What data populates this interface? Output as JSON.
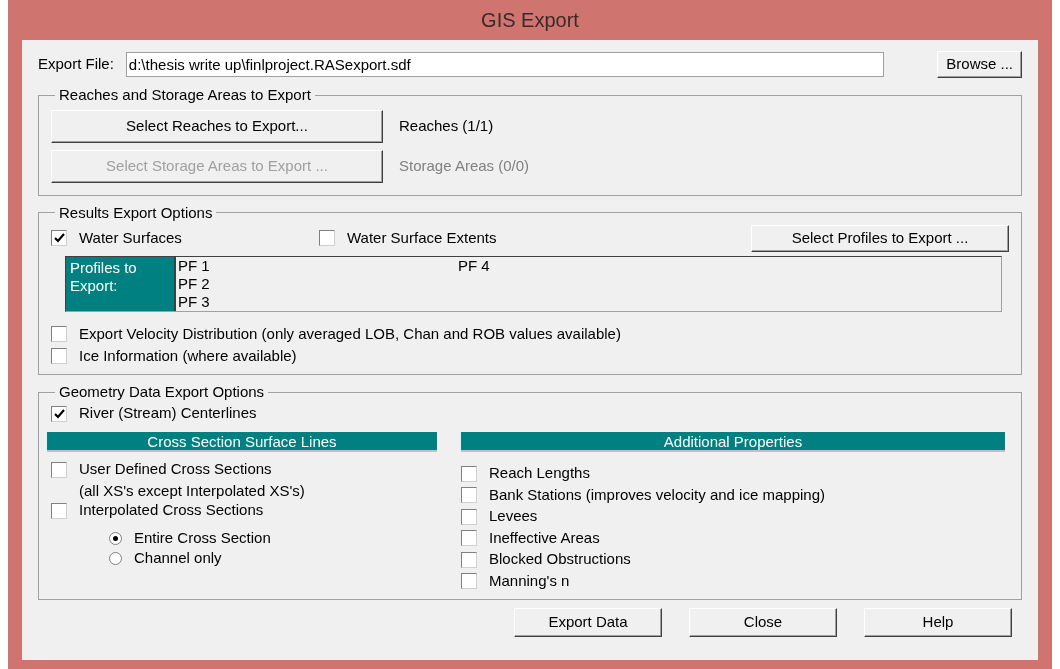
{
  "window": {
    "title": "GIS Export"
  },
  "export_file": {
    "label": "Export File:",
    "value": "d:\\thesis write up\\finlproject.RASexport.sdf",
    "browse": "Browse ..."
  },
  "reaches_group": {
    "title": "Reaches and Storage Areas to Export",
    "rows": [
      {
        "button": "Select Reaches to Export...",
        "disabled": false,
        "status": "Reaches (1/1)"
      },
      {
        "button": "Select Storage Areas to Export ...",
        "disabled": true,
        "status": "Storage Areas (0/0)"
      }
    ]
  },
  "results_group": {
    "title": "Results Export Options",
    "water_surfaces": {
      "label": "Water Surfaces",
      "checked": true
    },
    "water_surface_extents": {
      "label": "Water Surface Extents",
      "checked": false
    },
    "select_profiles": "Select Profiles to Export ...",
    "profiles_label": "Profiles to Export:",
    "profiles": [
      "PF 1",
      "PF 2",
      "PF 3",
      "PF 4"
    ],
    "options": [
      {
        "label": "Export Velocity Distribution (only averaged LOB, Chan and ROB values available)",
        "checked": false
      },
      {
        "label": "Ice Information (where available)",
        "checked": false
      }
    ]
  },
  "geometry_group": {
    "title": "Geometry Data Export Options",
    "centerlines": {
      "label": "River (Stream) Centerlines",
      "checked": true
    },
    "cross_section": {
      "header": "Cross Section Surface Lines",
      "items": [
        {
          "label": "User Defined Cross Sections",
          "note": "(all XS's except Interpolated XS's)",
          "checked": false
        },
        {
          "label": "Interpolated Cross Sections",
          "checked": false
        }
      ],
      "extent": [
        {
          "label": "Entire Cross Section",
          "selected": true
        },
        {
          "label": "Channel only",
          "selected": false
        }
      ]
    },
    "additional": {
      "header": "Additional Properties",
      "items": [
        {
          "label": "Reach Lengths",
          "checked": false
        },
        {
          "label": "Bank Stations (improves velocity and ice mapping)",
          "checked": false
        },
        {
          "label": "Levees",
          "checked": false
        },
        {
          "label": "Ineffective Areas",
          "checked": false
        },
        {
          "label": "Blocked Obstructions",
          "checked": false
        },
        {
          "label": "Manning's n",
          "checked": false
        }
      ]
    }
  },
  "buttons": [
    "Export Data",
    "Close",
    "Help"
  ]
}
